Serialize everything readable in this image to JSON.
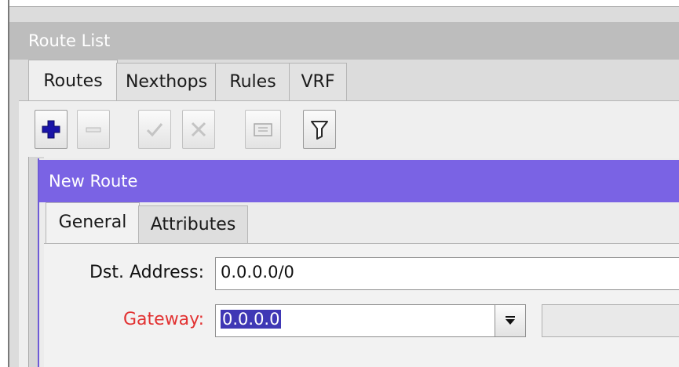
{
  "window": {
    "title": "Route List",
    "tabs": [
      {
        "label": "Routes",
        "active": true
      },
      {
        "label": "Nexthops",
        "active": false
      },
      {
        "label": "Rules",
        "active": false
      },
      {
        "label": "VRF",
        "active": false
      }
    ],
    "toolbar": [
      {
        "icon": "plus-icon",
        "enabled": true
      },
      {
        "icon": "minus-icon",
        "enabled": false
      },
      {
        "icon": "check-icon",
        "enabled": false
      },
      {
        "icon": "cross-icon",
        "enabled": false
      },
      {
        "icon": "comment-icon",
        "enabled": false
      },
      {
        "icon": "filter-icon",
        "enabled": true
      }
    ]
  },
  "dialog": {
    "title": "New Route",
    "tabs": [
      {
        "label": "General",
        "active": true
      },
      {
        "label": "Attributes",
        "active": false
      }
    ],
    "fields": {
      "dst_address": {
        "label": "Dst. Address:",
        "value": "0.0.0.0/0"
      },
      "gateway": {
        "label": "Gateway:",
        "value": "0.0.0.0",
        "label_color": "#e23232"
      }
    }
  },
  "colors": {
    "dialog_title_bar": "#7a63e4",
    "window_title_bar": "#bdbdbd",
    "selection": "#3f38b5",
    "required_label": "#e23232"
  }
}
